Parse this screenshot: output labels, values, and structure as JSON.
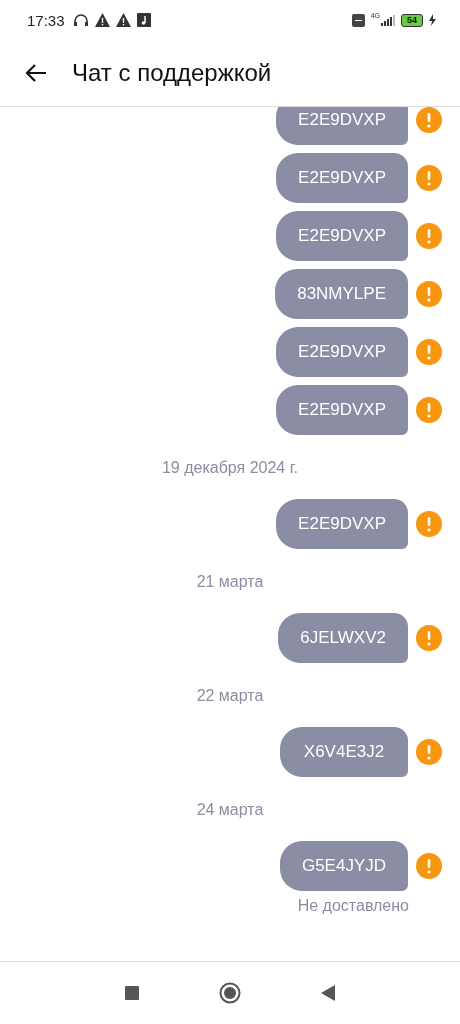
{
  "status_bar": {
    "time": "17:33",
    "network": "4G",
    "battery": "54"
  },
  "header": {
    "title": "Чат с поддержкой"
  },
  "messages": [
    {
      "kind": "message",
      "text": "E2E9DVXP",
      "failed": true
    },
    {
      "kind": "message",
      "text": "E2E9DVXP",
      "failed": true
    },
    {
      "kind": "message",
      "text": "E2E9DVXP",
      "failed": true
    },
    {
      "kind": "message",
      "text": "83NMYLPE",
      "failed": true
    },
    {
      "kind": "message",
      "text": "E2E9DVXP",
      "failed": true
    },
    {
      "kind": "message",
      "text": "E2E9DVXP",
      "failed": true
    },
    {
      "kind": "date",
      "text": "19 декабря 2024 г."
    },
    {
      "kind": "message",
      "text": "E2E9DVXP",
      "failed": true
    },
    {
      "kind": "date",
      "text": "21 марта"
    },
    {
      "kind": "message",
      "text": "6JELWXV2",
      "failed": true
    },
    {
      "kind": "date",
      "text": "22 марта"
    },
    {
      "kind": "message",
      "text": "X6V4E3J2",
      "failed": true
    },
    {
      "kind": "date",
      "text": "24 марта"
    },
    {
      "kind": "message",
      "text": "G5E4JYJD",
      "failed": true,
      "status": "Не доставлено"
    }
  ]
}
